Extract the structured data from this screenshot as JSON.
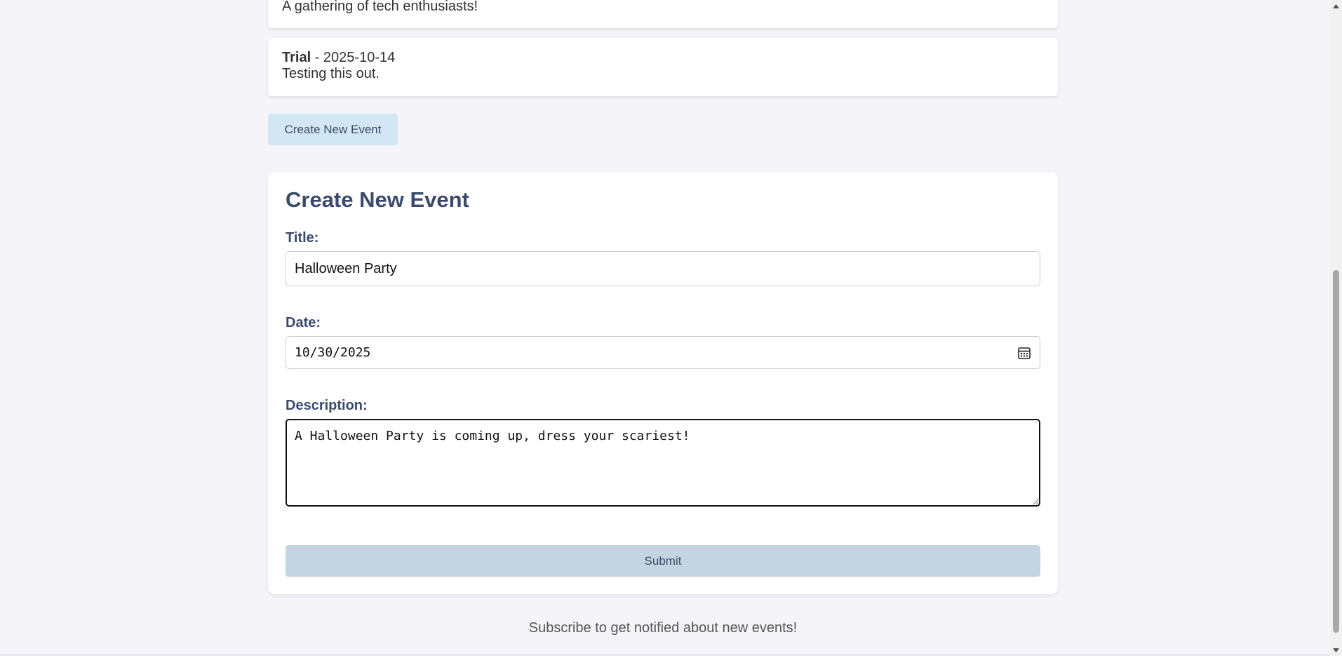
{
  "events": [
    {
      "title": "",
      "date": "",
      "description": "A gathering of tech enthusiasts!"
    },
    {
      "title": "Trial",
      "separator": " - ",
      "date": "2025-10-14",
      "description": "Testing this out."
    }
  ],
  "toggle_button": {
    "label": "Create New Event"
  },
  "form": {
    "heading": "Create New Event",
    "title_label": "Title:",
    "title_value": "Halloween Party",
    "date_label": "Date:",
    "date_value": "10/30/2025",
    "description_label": "Description:",
    "description_value": "A Halloween Party is coming up, dress your scariest!",
    "submit_label": "Submit"
  },
  "footer": {
    "text": "Subscribe to get notified about new events!"
  },
  "icons": {
    "date_picker": "calendar-icon",
    "scroll_up": "arrow-up-icon",
    "scroll_down": "arrow-down-icon"
  },
  "colors": {
    "background": "#f4f4f9",
    "heading": "#3b4a6b",
    "toggle_button_bg": "#d3e6f3",
    "submit_button_bg": "#c3d5e1"
  }
}
